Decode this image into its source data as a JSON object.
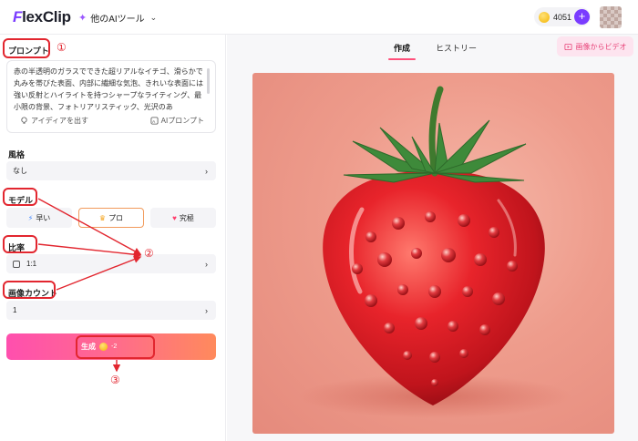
{
  "header": {
    "logo_prefix": "F",
    "logo_rest": "lexClip",
    "ai_tools_label": "他のAIツール",
    "credits": "4051"
  },
  "left": {
    "prompt_label": "プロンプト",
    "prompt_text": "赤の半透明のガラスでできた超リアルなイチゴ、滑らかで丸みを帯びた表面、内部に繊細な気泡、きれいな表面には強い反射とハイライトを持つシャープなライティング、最小限の背景、フォトリアリスティック、光沢のあ",
    "idea_button": "アイディアを出す",
    "ai_prompt_button": "AIプロンプト",
    "style_label": "風格",
    "style_value": "なし",
    "model_label": "モデル",
    "models": [
      {
        "label": "早い",
        "icon": "bolt-icon"
      },
      {
        "label": "プロ",
        "icon": "crown-icon"
      },
      {
        "label": "究極",
        "icon": "diamond-icon"
      }
    ],
    "ratio_label": "比率",
    "ratio_value": "1:1",
    "count_label": "画像カウント",
    "count_value": "1",
    "generate_label": "生成",
    "generate_cost": "-2",
    "annotations": [
      "①",
      "②",
      "③"
    ]
  },
  "right": {
    "tab_create": "作成",
    "tab_history": "ヒストリー",
    "img_to_video": "画像からビデオ"
  },
  "colors": {
    "accent_purple": "#7a3cff",
    "annotation_red": "#e2262f",
    "generate_gradient_start": "#ff4fae",
    "generate_gradient_end": "#ff8a5c",
    "tab_underline": "#ff4f7a"
  }
}
